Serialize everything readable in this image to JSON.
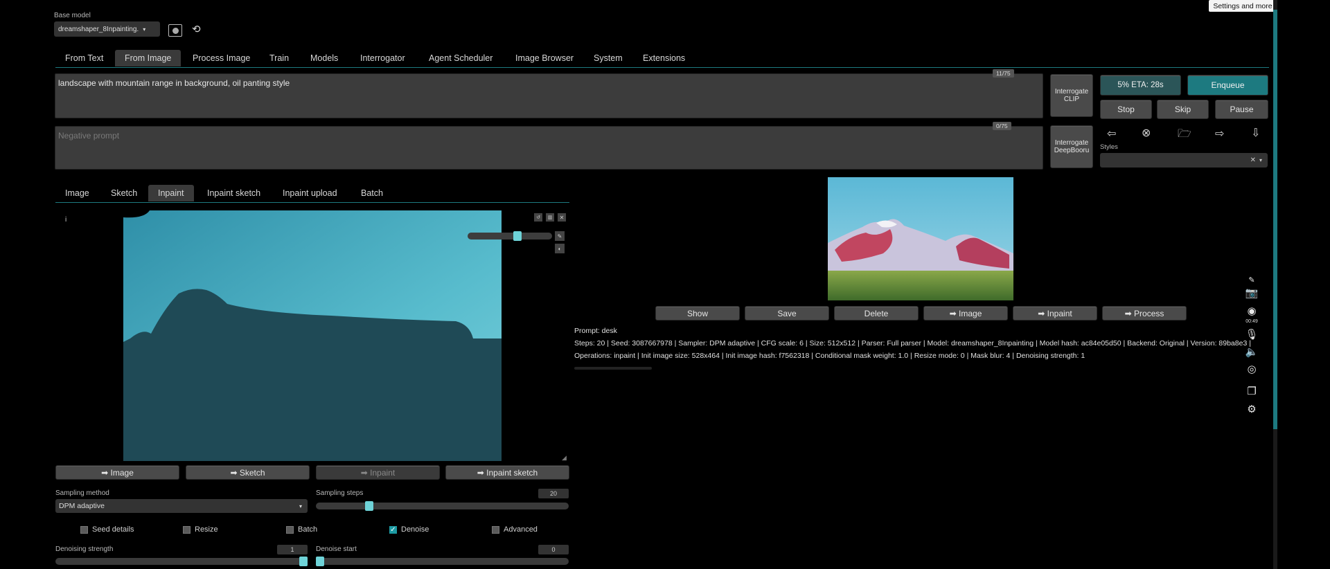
{
  "header": {
    "base_model_label": "Base model",
    "model_value": "dreamshaper_8Inpainting.",
    "tooltip": "Settings and more"
  },
  "main_tabs": [
    "From Text",
    "From Image",
    "Process Image",
    "Train",
    "Models",
    "Interrogator",
    "Agent Scheduler",
    "Image Browser",
    "System",
    "Extensions"
  ],
  "prompt": {
    "text": "landscape with mountain range in background, oil panting style",
    "counter": "11/75",
    "negative_placeholder": "Negative prompt",
    "negative_counter": "0/75"
  },
  "interrogate": {
    "clip": "Interrogate CLIP",
    "deepbooru": "Interrogate DeepBooru"
  },
  "controls": {
    "progress": "5% ETA: 28s",
    "enqueue": "Enqueue",
    "stop": "Stop",
    "skip": "Skip",
    "pause": "Pause",
    "styles_label": "Styles",
    "icons": [
      "arrow-left-icon",
      "clear-icon",
      "folder-icon",
      "arrow-right-icon",
      "arrow-down-icon"
    ]
  },
  "image_tabs": [
    "Image",
    "Sketch",
    "Inpaint",
    "Inpaint sketch",
    "Inpaint upload",
    "Batch"
  ],
  "canvas": {
    "corner_marker": "i",
    "brush_size": 0.6
  },
  "send_buttons": [
    "➡ Image",
    "➡ Sketch",
    "➡ Inpaint",
    "➡ Inpaint sketch"
  ],
  "sampling": {
    "method_label": "Sampling method",
    "method_value": "DPM adaptive",
    "steps_label": "Sampling steps",
    "steps_value": "20",
    "steps_fraction": 0.2
  },
  "checkboxes": [
    {
      "label": "Seed details",
      "checked": false
    },
    {
      "label": "Resize",
      "checked": false
    },
    {
      "label": "Batch",
      "checked": false
    },
    {
      "label": "Denoise",
      "checked": true
    },
    {
      "label": "Advanced",
      "checked": false
    }
  ],
  "denoise": {
    "strength_label": "Denoising strength",
    "strength_value": "1",
    "start_label": "Denoise start",
    "start_value": "0"
  },
  "output_buttons": [
    "Show",
    "Save",
    "Delete",
    "➡ Image",
    "➡ Inpaint",
    "➡ Process"
  ],
  "output_info": {
    "prompt": "Prompt: desk",
    "line1": "Steps: 20 | Seed: 3087667978 | Sampler: DPM adaptive | CFG scale: 6 | Size: 512x512 | Parser: Full parser | Model: dreamshaper_8Inpainting | Model hash: ac84e05d50 | Backend: Original | Version: 89ba8e3 |",
    "line2": "Operations: inpaint | Init image size: 528x464 | Init image hash: f7562318 | Conditional mask weight: 1.0 | Resize mode: 0 | Mask blur: 4 | Denoising strength: 1"
  },
  "side_toolbar": {
    "time": "00:49"
  },
  "colors": {
    "accent": "#1d7a80",
    "slider": "#6ed3d8",
    "canvas_sky": "#4fb4c8",
    "canvas_mask": "#1f4a56"
  }
}
